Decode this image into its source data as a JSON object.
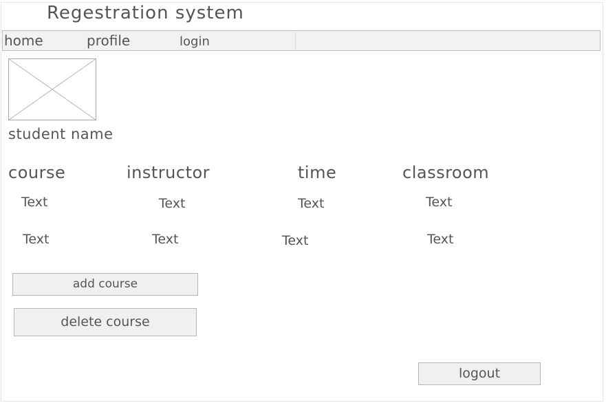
{
  "app": {
    "title": "Regestration system"
  },
  "nav": {
    "items": [
      {
        "label": "home"
      },
      {
        "label": "profile"
      },
      {
        "label": "login"
      }
    ]
  },
  "profile": {
    "student_name": "student name"
  },
  "table": {
    "headers": [
      "course",
      "instructor",
      "time",
      "classroom"
    ],
    "rows": [
      [
        "Text",
        "Text",
        "Text",
        "Text"
      ],
      [
        "Text",
        "Text",
        "Text",
        "Text"
      ]
    ]
  },
  "actions": {
    "add_course": "add course",
    "delete_course": "delete course",
    "logout": "logout"
  },
  "colors": {
    "navbar_bg": "#f2f2f2",
    "button_bg": "#f0f0f0",
    "border": "#b5b5b5",
    "text": "#555555"
  },
  "icons": {
    "avatar": "image-placeholder-icon"
  }
}
